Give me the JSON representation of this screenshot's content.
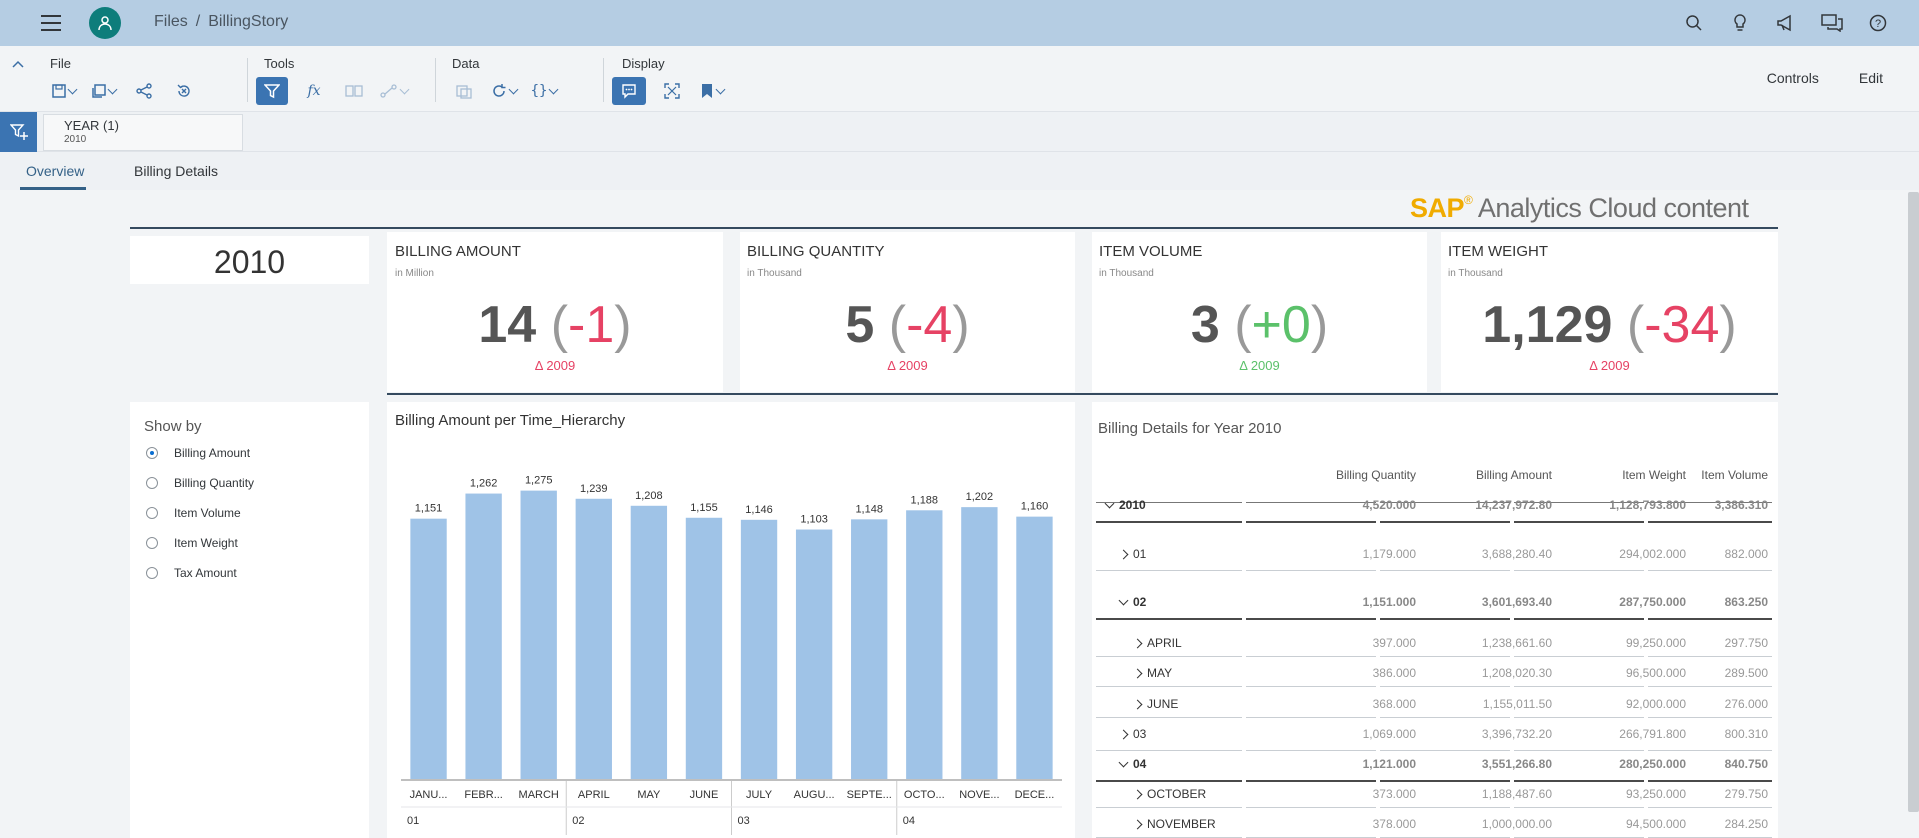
{
  "shell": {
    "breadcrumb_root": "Files",
    "breadcrumb_sep": "/",
    "breadcrumb_current": "BillingStory",
    "icons": [
      "search-icon",
      "lightbulb-icon",
      "announcement-icon",
      "discussion-icon",
      "help-icon"
    ]
  },
  "toolbar": {
    "file_label": "File",
    "tools_label": "Tools",
    "data_label": "Data",
    "display_label": "Display",
    "controls_label": "Controls",
    "edit_label": "Edit",
    "active_color": "#3b74b2"
  },
  "filterbar": {
    "filter_name": "YEAR (1)",
    "filter_value": "2010"
  },
  "tabs": [
    {
      "label": "Overview",
      "selected": true
    },
    {
      "label": "Billing Details",
      "selected": false
    }
  ],
  "branding": {
    "sap": "SAP",
    "reg": "®",
    "rest": " Analytics Cloud content"
  },
  "year_card": {
    "value": "2010"
  },
  "kpis": [
    {
      "title": "BILLING AMOUNT",
      "subtitle": "in Million",
      "value": "14",
      "open": "(",
      "delta": "-1",
      "close": ")",
      "delta_label": "Δ 2009",
      "trend": "neg"
    },
    {
      "title": "BILLING QUANTITY",
      "subtitle": "in Thousand",
      "value": "5",
      "open": "(",
      "delta": "-4",
      "close": ")",
      "delta_label": "Δ 2009",
      "trend": "neg"
    },
    {
      "title": "ITEM VOLUME",
      "subtitle": "in Thousand",
      "value": "3",
      "open": "(",
      "delta": "+0",
      "close": ")",
      "delta_label": "Δ 2009",
      "trend": "pos"
    },
    {
      "title": "ITEM WEIGHT",
      "subtitle": "in Thousand",
      "value": "1,129",
      "open": "(",
      "delta": "-34",
      "close": ")",
      "delta_label": "Δ 2009",
      "trend": "neg"
    }
  ],
  "showby": {
    "title": "Show by",
    "options": [
      {
        "label": "Billing Amount",
        "selected": true
      },
      {
        "label": "Billing Quantity",
        "selected": false
      },
      {
        "label": "Item Volume",
        "selected": false
      },
      {
        "label": "Item Weight",
        "selected": false
      },
      {
        "label": "Tax Amount",
        "selected": false
      }
    ]
  },
  "chart_data": {
    "type": "bar",
    "title": "Billing Amount per Time_Hierarchy",
    "categories": [
      "JANU...",
      "FEBR...",
      "MARCH",
      "APRIL",
      "MAY",
      "JUNE",
      "JULY",
      "AUGU...",
      "SEPTE...",
      "OCTO...",
      "NOVE...",
      "DECE..."
    ],
    "values": [
      1151,
      1262,
      1275,
      1239,
      1208,
      1155,
      1146,
      1103,
      1148,
      1188,
      1202,
      1160
    ],
    "value_labels": [
      "1,151",
      "1,262",
      "1,275",
      "1,239",
      "1,208",
      "1,155",
      "1,146",
      "1,103",
      "1,148",
      "1,188",
      "1,202",
      "1,160"
    ],
    "groups": [
      {
        "label": "01",
        "count": 3
      },
      {
        "label": "02",
        "count": 3
      },
      {
        "label": "03",
        "count": 3
      },
      {
        "label": "04",
        "count": 3
      }
    ],
    "ylim": [
      0,
      1300
    ],
    "bar_color": "#9fc3e7",
    "grid": false
  },
  "table": {
    "title": "Billing Details for Year 2010",
    "columns": [
      "Billing Quantity",
      "Billing Amount",
      "Item Weight",
      "Item Volume"
    ],
    "rows": [
      {
        "label": "2010",
        "level": 0,
        "expand": "down",
        "bold": true,
        "values": [
          "4,520.000",
          "14,237,972.80",
          "1,128,793.800",
          "3,386.310"
        ]
      },
      {
        "label": "01",
        "level": 1,
        "expand": "right",
        "bold": false,
        "values": [
          "1,179.000",
          "3,688,280.40",
          "294,002.000",
          "882.000"
        ]
      },
      {
        "label": "02",
        "level": 1,
        "expand": "down",
        "bold": true,
        "values": [
          "1,151.000",
          "3,601,693.40",
          "287,750.000",
          "863.250"
        ]
      },
      {
        "label": "APRIL",
        "level": 2,
        "expand": "right",
        "bold": false,
        "values": [
          "397.000",
          "1,238,661.60",
          "99,250.000",
          "297.750"
        ]
      },
      {
        "label": "MAY",
        "level": 2,
        "expand": "right",
        "bold": false,
        "values": [
          "386.000",
          "1,208,020.30",
          "96,500.000",
          "289.500"
        ]
      },
      {
        "label": "JUNE",
        "level": 2,
        "expand": "right",
        "bold": false,
        "values": [
          "368.000",
          "1,155,011.50",
          "92,000.000",
          "276.000"
        ]
      },
      {
        "label": "03",
        "level": 1,
        "expand": "right",
        "bold": false,
        "values": [
          "1,069.000",
          "3,396,732.20",
          "266,791.800",
          "800.310"
        ]
      },
      {
        "label": "04",
        "level": 1,
        "expand": "down",
        "bold": true,
        "values": [
          "1,121.000",
          "3,551,266.80",
          "280,250.000",
          "840.750"
        ]
      },
      {
        "label": "OCTOBER",
        "level": 2,
        "expand": "right",
        "bold": false,
        "values": [
          "373.000",
          "1,188,487.60",
          "93,250.000",
          "279.750"
        ]
      },
      {
        "label": "NOVEMBER",
        "level": 2,
        "expand": "right",
        "bold": false,
        "values": [
          "378.000",
          "1,000,000.00",
          "94,500.000",
          "284.250"
        ]
      }
    ]
  }
}
